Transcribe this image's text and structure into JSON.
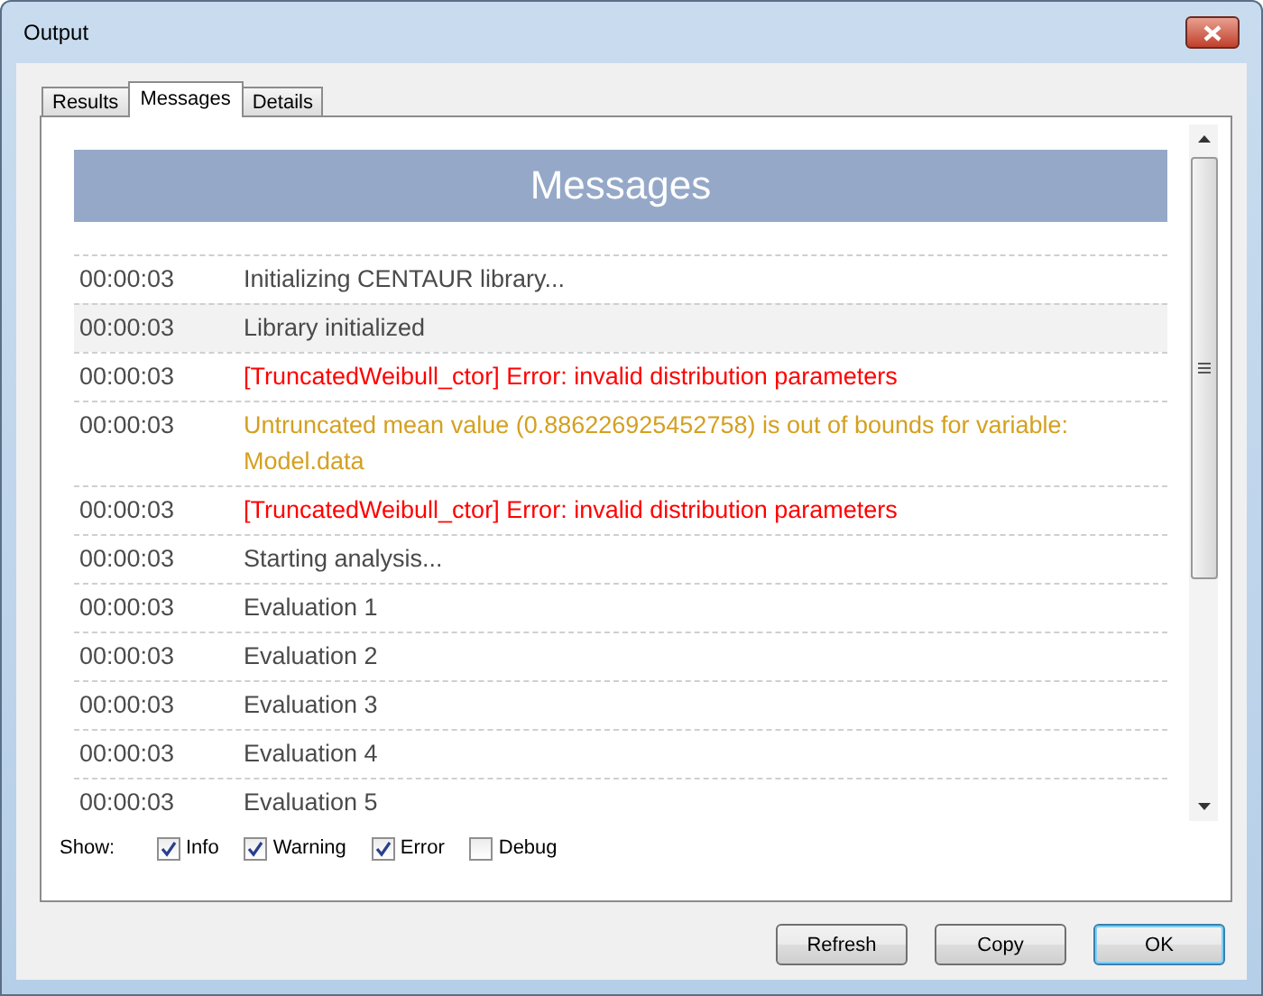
{
  "window": {
    "title": "Output"
  },
  "tabs": [
    {
      "label": "Results",
      "selected": false
    },
    {
      "label": "Messages",
      "selected": true
    },
    {
      "label": "Details",
      "selected": false
    }
  ],
  "log": {
    "heading": "Messages",
    "rows": [
      {
        "time": "00:00:03",
        "text": "Initializing CENTAUR library...",
        "kind": "info",
        "selected": false
      },
      {
        "time": "00:00:03",
        "text": "Library initialized",
        "kind": "info",
        "selected": true
      },
      {
        "time": "00:00:03",
        "text": "[TruncatedWeibull_ctor] Error: invalid distribution parameters",
        "kind": "error",
        "selected": false
      },
      {
        "time": "00:00:03",
        "text": "Untruncated mean value (0.886226925452758) is out of bounds for variable: Model.data",
        "kind": "warning",
        "selected": false
      },
      {
        "time": "00:00:03",
        "text": "[TruncatedWeibull_ctor] Error: invalid distribution parameters",
        "kind": "error",
        "selected": false
      },
      {
        "time": "00:00:03",
        "text": "Starting analysis...",
        "kind": "info",
        "selected": false
      },
      {
        "time": "00:00:03",
        "text": "Evaluation 1",
        "kind": "info",
        "selected": false
      },
      {
        "time": "00:00:03",
        "text": "Evaluation 2",
        "kind": "info",
        "selected": false
      },
      {
        "time": "00:00:03",
        "text": "Evaluation 3",
        "kind": "info",
        "selected": false
      },
      {
        "time": "00:00:03",
        "text": "Evaluation 4",
        "kind": "info",
        "selected": false
      },
      {
        "time": "00:00:03",
        "text": "Evaluation 5",
        "kind": "info",
        "selected": false
      }
    ]
  },
  "filters": {
    "label": "Show:",
    "options": [
      {
        "label": "Info",
        "checked": true
      },
      {
        "label": "Warning",
        "checked": true
      },
      {
        "label": "Error",
        "checked": true
      },
      {
        "label": "Debug",
        "checked": false
      }
    ]
  },
  "buttons": [
    {
      "label": "Refresh",
      "kind": "normal"
    },
    {
      "label": "Copy",
      "kind": "normal"
    },
    {
      "label": "OK",
      "kind": "default"
    }
  ]
}
